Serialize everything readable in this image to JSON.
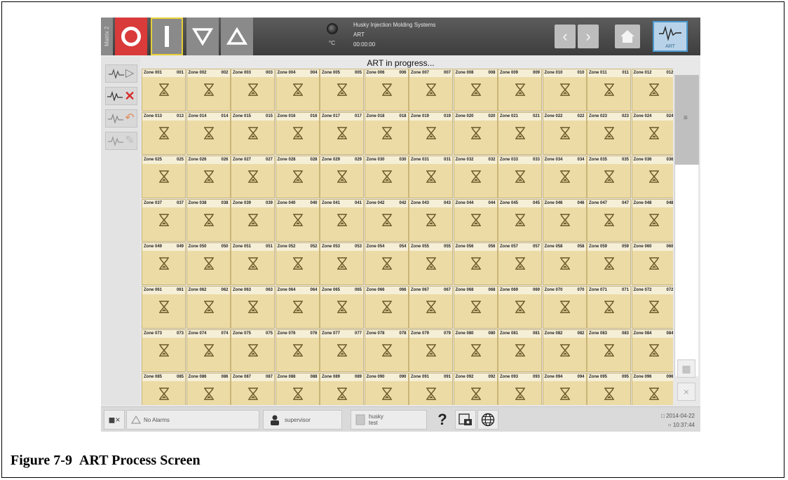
{
  "header": {
    "matrix_tab": "Matrix 2",
    "system_name": "Husky Injection Molding Systems",
    "mode": "ART",
    "elapsed": "00:00:00",
    "temp_unit": "°C",
    "art_button_label": "ART"
  },
  "progress": {
    "label": "ART in progress..."
  },
  "zones": [
    {
      "title": "Zone 001",
      "num": "001"
    },
    {
      "title": "Zone 002",
      "num": "002"
    },
    {
      "title": "Zone 003",
      "num": "003"
    },
    {
      "title": "Zone 004",
      "num": "004"
    },
    {
      "title": "Zone 005",
      "num": "005"
    },
    {
      "title": "Zone 006",
      "num": "006"
    },
    {
      "title": "Zone 007",
      "num": "007"
    },
    {
      "title": "Zone 008",
      "num": "008"
    },
    {
      "title": "Zone 009",
      "num": "009"
    },
    {
      "title": "Zone 010",
      "num": "010"
    },
    {
      "title": "Zone 011",
      "num": "011"
    },
    {
      "title": "Zone 012",
      "num": "012"
    },
    {
      "title": "Zone 013",
      "num": "013"
    },
    {
      "title": "Zone 014",
      "num": "014"
    },
    {
      "title": "Zone 015",
      "num": "015"
    },
    {
      "title": "Zone 016",
      "num": "016"
    },
    {
      "title": "Zone 017",
      "num": "017"
    },
    {
      "title": "Zone 018",
      "num": "018"
    },
    {
      "title": "Zone 019",
      "num": "019"
    },
    {
      "title": "Zone 020",
      "num": "020"
    },
    {
      "title": "Zone 021",
      "num": "021"
    },
    {
      "title": "Zone 022",
      "num": "022"
    },
    {
      "title": "Zone 023",
      "num": "023"
    },
    {
      "title": "Zone 024",
      "num": "024"
    },
    {
      "title": "Zone 025",
      "num": "025"
    },
    {
      "title": "Zone 026",
      "num": "026"
    },
    {
      "title": "Zone 027",
      "num": "027"
    },
    {
      "title": "Zone 028",
      "num": "028"
    },
    {
      "title": "Zone 029",
      "num": "029"
    },
    {
      "title": "Zone 030",
      "num": "030"
    },
    {
      "title": "Zone 031",
      "num": "031"
    },
    {
      "title": "Zone 032",
      "num": "032"
    },
    {
      "title": "Zone 033",
      "num": "033"
    },
    {
      "title": "Zone 034",
      "num": "034"
    },
    {
      "title": "Zone 035",
      "num": "035"
    },
    {
      "title": "Zone 036",
      "num": "036"
    },
    {
      "title": "Zone 037",
      "num": "037"
    },
    {
      "title": "Zone 038",
      "num": "038"
    },
    {
      "title": "Zone 039",
      "num": "039"
    },
    {
      "title": "Zone 040",
      "num": "040"
    },
    {
      "title": "Zone 041",
      "num": "041"
    },
    {
      "title": "Zone 042",
      "num": "042"
    },
    {
      "title": "Zone 043",
      "num": "043"
    },
    {
      "title": "Zone 044",
      "num": "044"
    },
    {
      "title": "Zone 045",
      "num": "045"
    },
    {
      "title": "Zone 046",
      "num": "046"
    },
    {
      "title": "Zone 047",
      "num": "047"
    },
    {
      "title": "Zone 048",
      "num": "048"
    },
    {
      "title": "Zone 049",
      "num": "049"
    },
    {
      "title": "Zone 050",
      "num": "050"
    },
    {
      "title": "Zone 051",
      "num": "051"
    },
    {
      "title": "Zone 052",
      "num": "052"
    },
    {
      "title": "Zone 053",
      "num": "053"
    },
    {
      "title": "Zone 054",
      "num": "054"
    },
    {
      "title": "Zone 055",
      "num": "055"
    },
    {
      "title": "Zone 056",
      "num": "056"
    },
    {
      "title": "Zone 057",
      "num": "057"
    },
    {
      "title": "Zone 058",
      "num": "058"
    },
    {
      "title": "Zone 059",
      "num": "059"
    },
    {
      "title": "Zone 060",
      "num": "060"
    },
    {
      "title": "Zone 061",
      "num": "061"
    },
    {
      "title": "Zone 062",
      "num": "062"
    },
    {
      "title": "Zone 063",
      "num": "063"
    },
    {
      "title": "Zone 064",
      "num": "064"
    },
    {
      "title": "Zone 065",
      "num": "065"
    },
    {
      "title": "Zone 066",
      "num": "066"
    },
    {
      "title": "Zone 067",
      "num": "067"
    },
    {
      "title": "Zone 068",
      "num": "068"
    },
    {
      "title": "Zone 069",
      "num": "069"
    },
    {
      "title": "Zone 070",
      "num": "070"
    },
    {
      "title": "Zone 071",
      "num": "071"
    },
    {
      "title": "Zone 072",
      "num": "072"
    },
    {
      "title": "Zone 073",
      "num": "073"
    },
    {
      "title": "Zone 074",
      "num": "074"
    },
    {
      "title": "Zone 075",
      "num": "075"
    },
    {
      "title": "Zone 076",
      "num": "076"
    },
    {
      "title": "Zone 077",
      "num": "077"
    },
    {
      "title": "Zone 078",
      "num": "078"
    },
    {
      "title": "Zone 079",
      "num": "079"
    },
    {
      "title": "Zone 080",
      "num": "080"
    },
    {
      "title": "Zone 081",
      "num": "081"
    },
    {
      "title": "Zone 082",
      "num": "082"
    },
    {
      "title": "Zone 083",
      "num": "083"
    },
    {
      "title": "Zone 084",
      "num": "084"
    },
    {
      "title": "Zone 085",
      "num": "085"
    },
    {
      "title": "Zone 086",
      "num": "086"
    },
    {
      "title": "Zone 087",
      "num": "087"
    },
    {
      "title": "Zone 088",
      "num": "088"
    },
    {
      "title": "Zone 089",
      "num": "089"
    },
    {
      "title": "Zone 090",
      "num": "090"
    },
    {
      "title": "Zone 091",
      "num": "091"
    },
    {
      "title": "Zone 092",
      "num": "092"
    },
    {
      "title": "Zone 093",
      "num": "093"
    },
    {
      "title": "Zone 094",
      "num": "094"
    },
    {
      "title": "Zone 095",
      "num": "095"
    },
    {
      "title": "Zone 096",
      "num": "096"
    }
  ],
  "footer": {
    "alarms": "No Alarms",
    "user": "supervisor",
    "mold_line1": "husky",
    "mold_line2": "test",
    "help": "?",
    "date": "2014-04-22",
    "time": "10:37:44"
  },
  "caption": {
    "number": "Figure 7-9",
    "title": "ART Process Screen"
  },
  "colors": {
    "zone_fill": "#ecdba5",
    "off_button": "#d93a3a",
    "art_button": "#b8d3e9",
    "stop_x": "#d72b2b"
  },
  "icons": [
    "power-off-icon",
    "power-on-icon",
    "standby-icon",
    "boost-icon",
    "back-icon",
    "forward-icon",
    "home-icon",
    "waveform-icon",
    "hourglass-icon",
    "mute-icon",
    "alarm-icon",
    "user-icon",
    "mold-icon",
    "help-icon",
    "screenshot-icon",
    "globe-icon"
  ]
}
